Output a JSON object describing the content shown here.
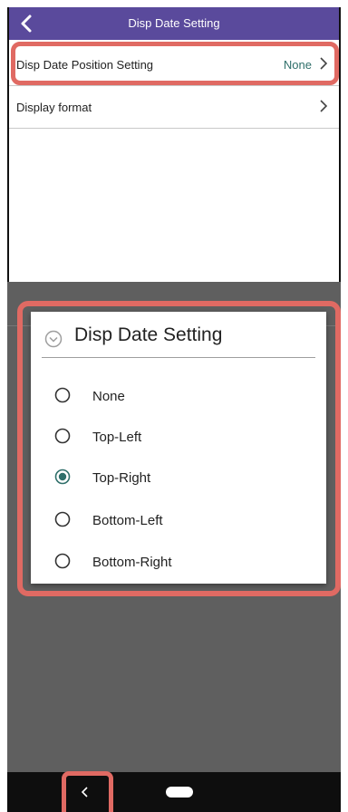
{
  "top_screen": {
    "appbar_title": "Disp Date Setting",
    "rows": [
      {
        "label": "Disp Date Position Setting",
        "value": "None"
      },
      {
        "label": "Display format",
        "value": ""
      }
    ]
  },
  "dialog": {
    "title": "Disp Date Setting",
    "options": [
      "None",
      "Top-Left",
      "Top-Right",
      "Bottom-Left",
      "Bottom-Right"
    ],
    "selected": "Top-Right"
  },
  "colors": {
    "appbar": "#5a4a9c",
    "highlight": "#e06a63",
    "radio_selected": "#2f6f6a",
    "value_text": "#2f6f6a"
  },
  "icons": {
    "back": "chevron-left-icon",
    "row_arrow": "chevron-right-icon",
    "dialog_title": "circle-chevron-down-icon",
    "nav_back": "nav-back-icon",
    "nav_home": "nav-home-pill-icon"
  }
}
